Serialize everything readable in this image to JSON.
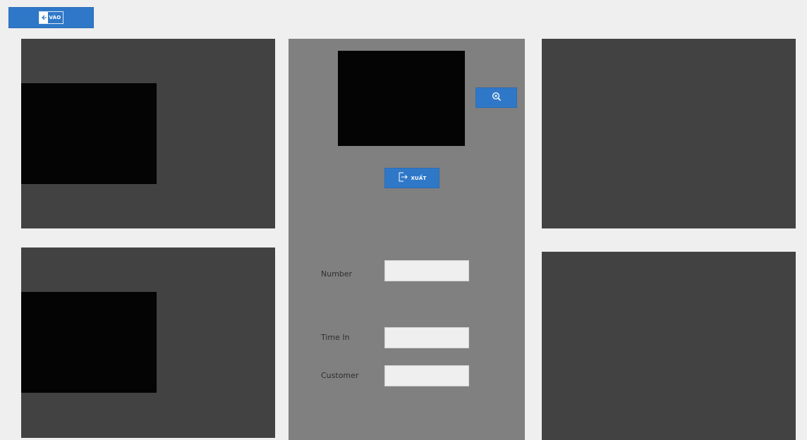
{
  "entry_button": {
    "label": "VÀO",
    "icon": "enter-arrow-icon"
  },
  "center_panel": {
    "exit_button": {
      "label": "XUẤT",
      "icon": "exit-door-icon"
    },
    "search_button": {
      "icon": "search-clear-icon"
    },
    "form": {
      "number_label": "Number",
      "number_value": "",
      "time_in_label": "Time In",
      "time_in_value": "",
      "customer_label": "Customer",
      "customer_value": ""
    }
  },
  "colors": {
    "background": "#efefef",
    "panel_dark": "#424242",
    "panel_mid": "#808080",
    "camera": "#040404",
    "accent": "#2f78c8"
  }
}
